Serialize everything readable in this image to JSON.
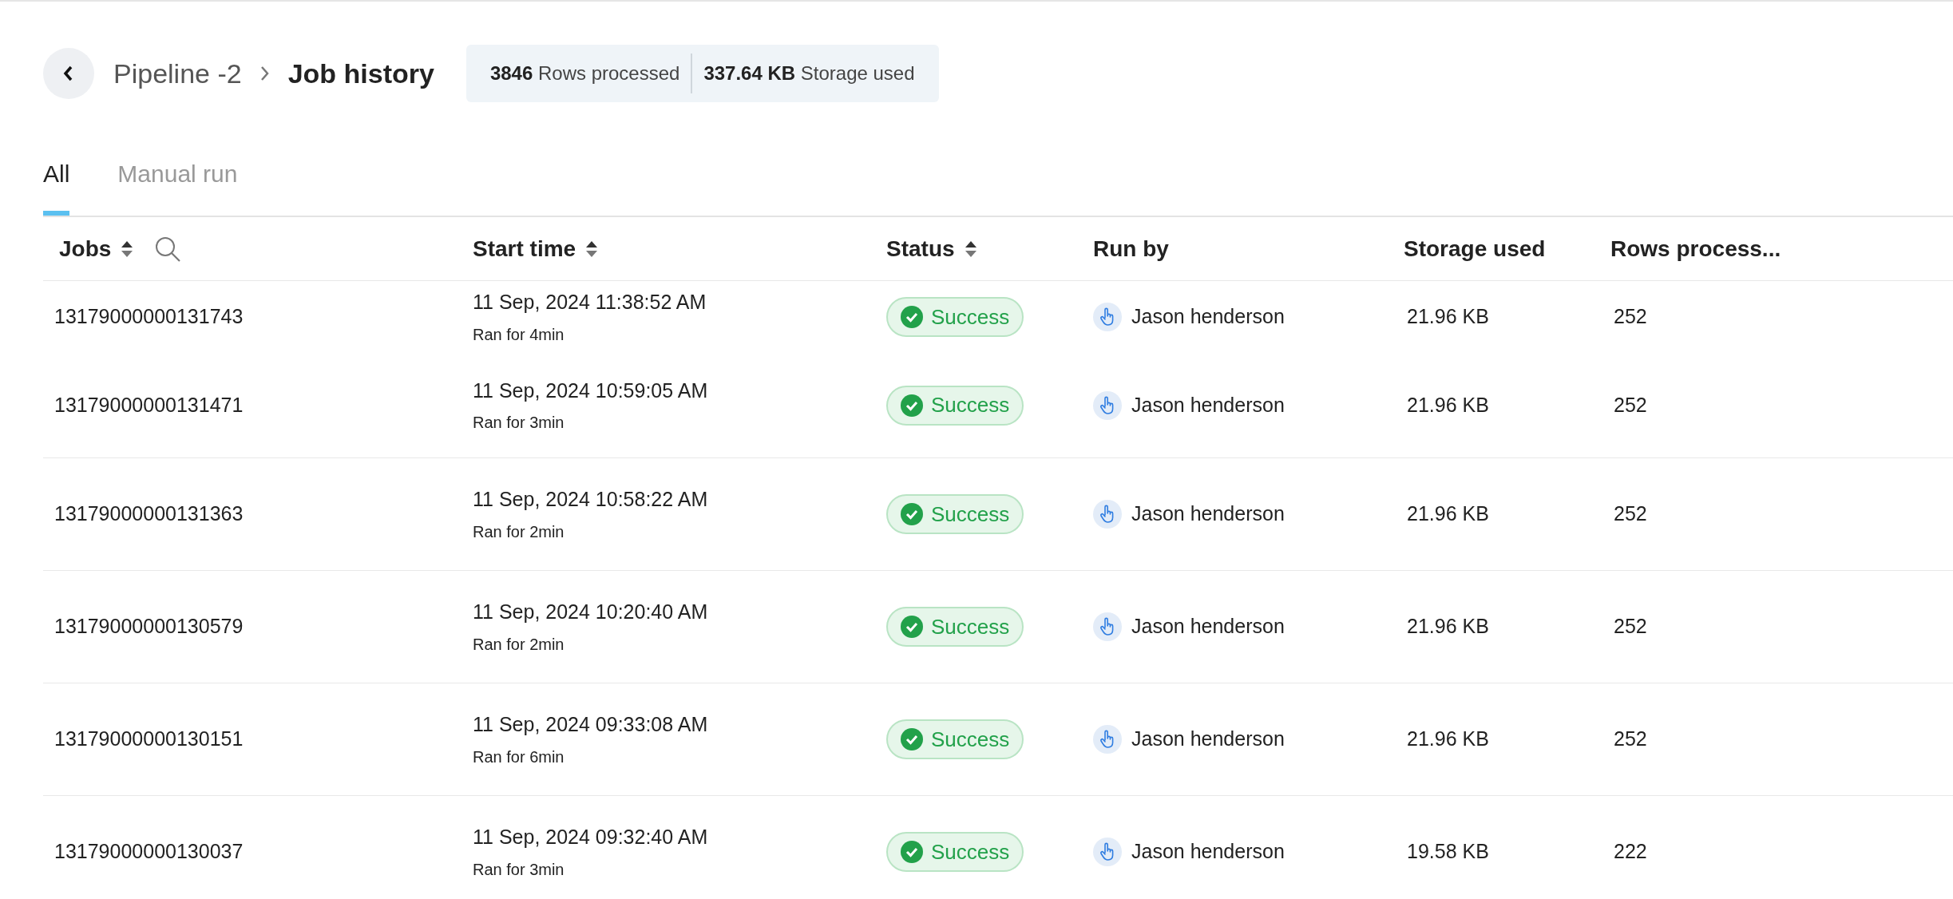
{
  "breadcrumb": {
    "parent": "Pipeline -2",
    "current": "Job history"
  },
  "summary": [
    "**3846** Rows processed",
    "**337.64 KB** Storage used"
  ],
  "tabs": [
    {
      "label": "All",
      "selected": true
    },
    {
      "label": "Manual run",
      "selected": false
    }
  ],
  "table": {
    "columns": [
      {
        "label": "Jobs",
        "sortable": true,
        "searchable": true
      },
      {
        "label": "Start time",
        "sortable": true,
        "searchable": false
      },
      {
        "label": "Status",
        "sortable": true,
        "searchable": false
      },
      {
        "label": "Run by",
        "sortable": false,
        "searchable": false
      },
      {
        "label": "Storage used",
        "sortable": false,
        "searchable": false
      },
      {
        "label": "Rows process...",
        "sortable": false,
        "searchable": false
      }
    ],
    "rows": [
      {
        "job": "13179000000131743",
        "start": "11 Sep, 2024 11:38:52 AM",
        "duration": "Ran for 4min",
        "status": {
          "kind": "success",
          "label": "Success"
        },
        "run_by": "Jason henderson",
        "storage": "21.96 KB",
        "rows": "252"
      },
      {
        "job": "13179000000131471",
        "start": "11 Sep, 2024 10:59:05 AM",
        "duration": "Ran for 3min",
        "status": {
          "kind": "success",
          "label": "Success"
        },
        "run_by": "Jason henderson",
        "storage": "21.96 KB",
        "rows": "252"
      },
      {
        "job": "13179000000131363",
        "start": "11 Sep, 2024 10:58:22 AM",
        "duration": "Ran for 2min",
        "status": {
          "kind": "success",
          "label": "Success"
        },
        "run_by": "Jason henderson",
        "storage": "21.96 KB",
        "rows": "252"
      },
      {
        "job": "13179000000130579",
        "start": "11 Sep, 2024 10:20:40 AM",
        "duration": "Ran for 2min",
        "status": {
          "kind": "success",
          "label": "Success"
        },
        "run_by": "Jason henderson",
        "storage": "21.96 KB",
        "rows": "252"
      },
      {
        "job": "13179000000130151",
        "start": "11 Sep, 2024 09:33:08 AM",
        "duration": "Ran for 6min",
        "status": {
          "kind": "success",
          "label": "Success"
        },
        "run_by": "Jason henderson",
        "storage": "21.96 KB",
        "rows": "252"
      },
      {
        "job": "13179000000130037",
        "start": "11 Sep, 2024 09:32:40 AM",
        "duration": "Ran for 3min",
        "status": {
          "kind": "success",
          "label": "Success"
        },
        "run_by": "Jason henderson",
        "storage": "19.58 KB",
        "rows": "222"
      }
    ]
  }
}
